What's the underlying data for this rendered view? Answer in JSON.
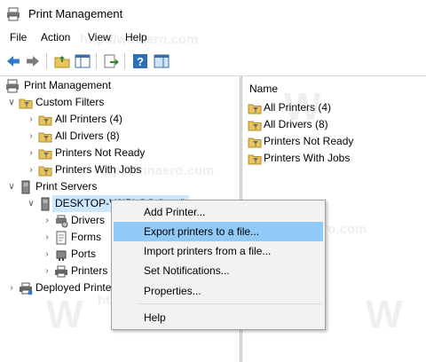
{
  "window": {
    "title": "Print Management"
  },
  "menu": [
    "File",
    "Action",
    "View",
    "Help"
  ],
  "toolbar": {
    "buttons": [
      "back-arrow-icon",
      "forward-arrow-icon",
      "up-folder-icon",
      "show-hide-tree-icon",
      "export-list-icon",
      "help-icon",
      "properties-pane-icon"
    ]
  },
  "tree": {
    "root": "Print Management",
    "custom_filters": {
      "label": "Custom Filters",
      "children": [
        "All Printers (4)",
        "All Drivers (8)",
        "Printers Not Ready",
        "Printers With Jobs"
      ]
    },
    "print_servers": {
      "label": "Print Servers",
      "server": "DESKTOP-V6IPLGC (local)",
      "children": [
        "Drivers",
        "Forms",
        "Ports",
        "Printers"
      ]
    },
    "deployed": "Deployed Printers"
  },
  "list": {
    "column": "Name",
    "items": [
      "All Printers (4)",
      "All Drivers (8)",
      "Printers Not Ready",
      "Printers With Jobs"
    ]
  },
  "context_menu": {
    "items": [
      "Add Printer...",
      "Export printers to a file...",
      "Import printers from a file...",
      "Set Notifications...",
      "Properties...",
      "Help"
    ],
    "highlighted_index": 1
  },
  "watermark": "http://winaero.com",
  "colors": {
    "selection": "#cce8ff",
    "menu_highlight": "#91c9f7",
    "folder": "#e8c45a"
  }
}
